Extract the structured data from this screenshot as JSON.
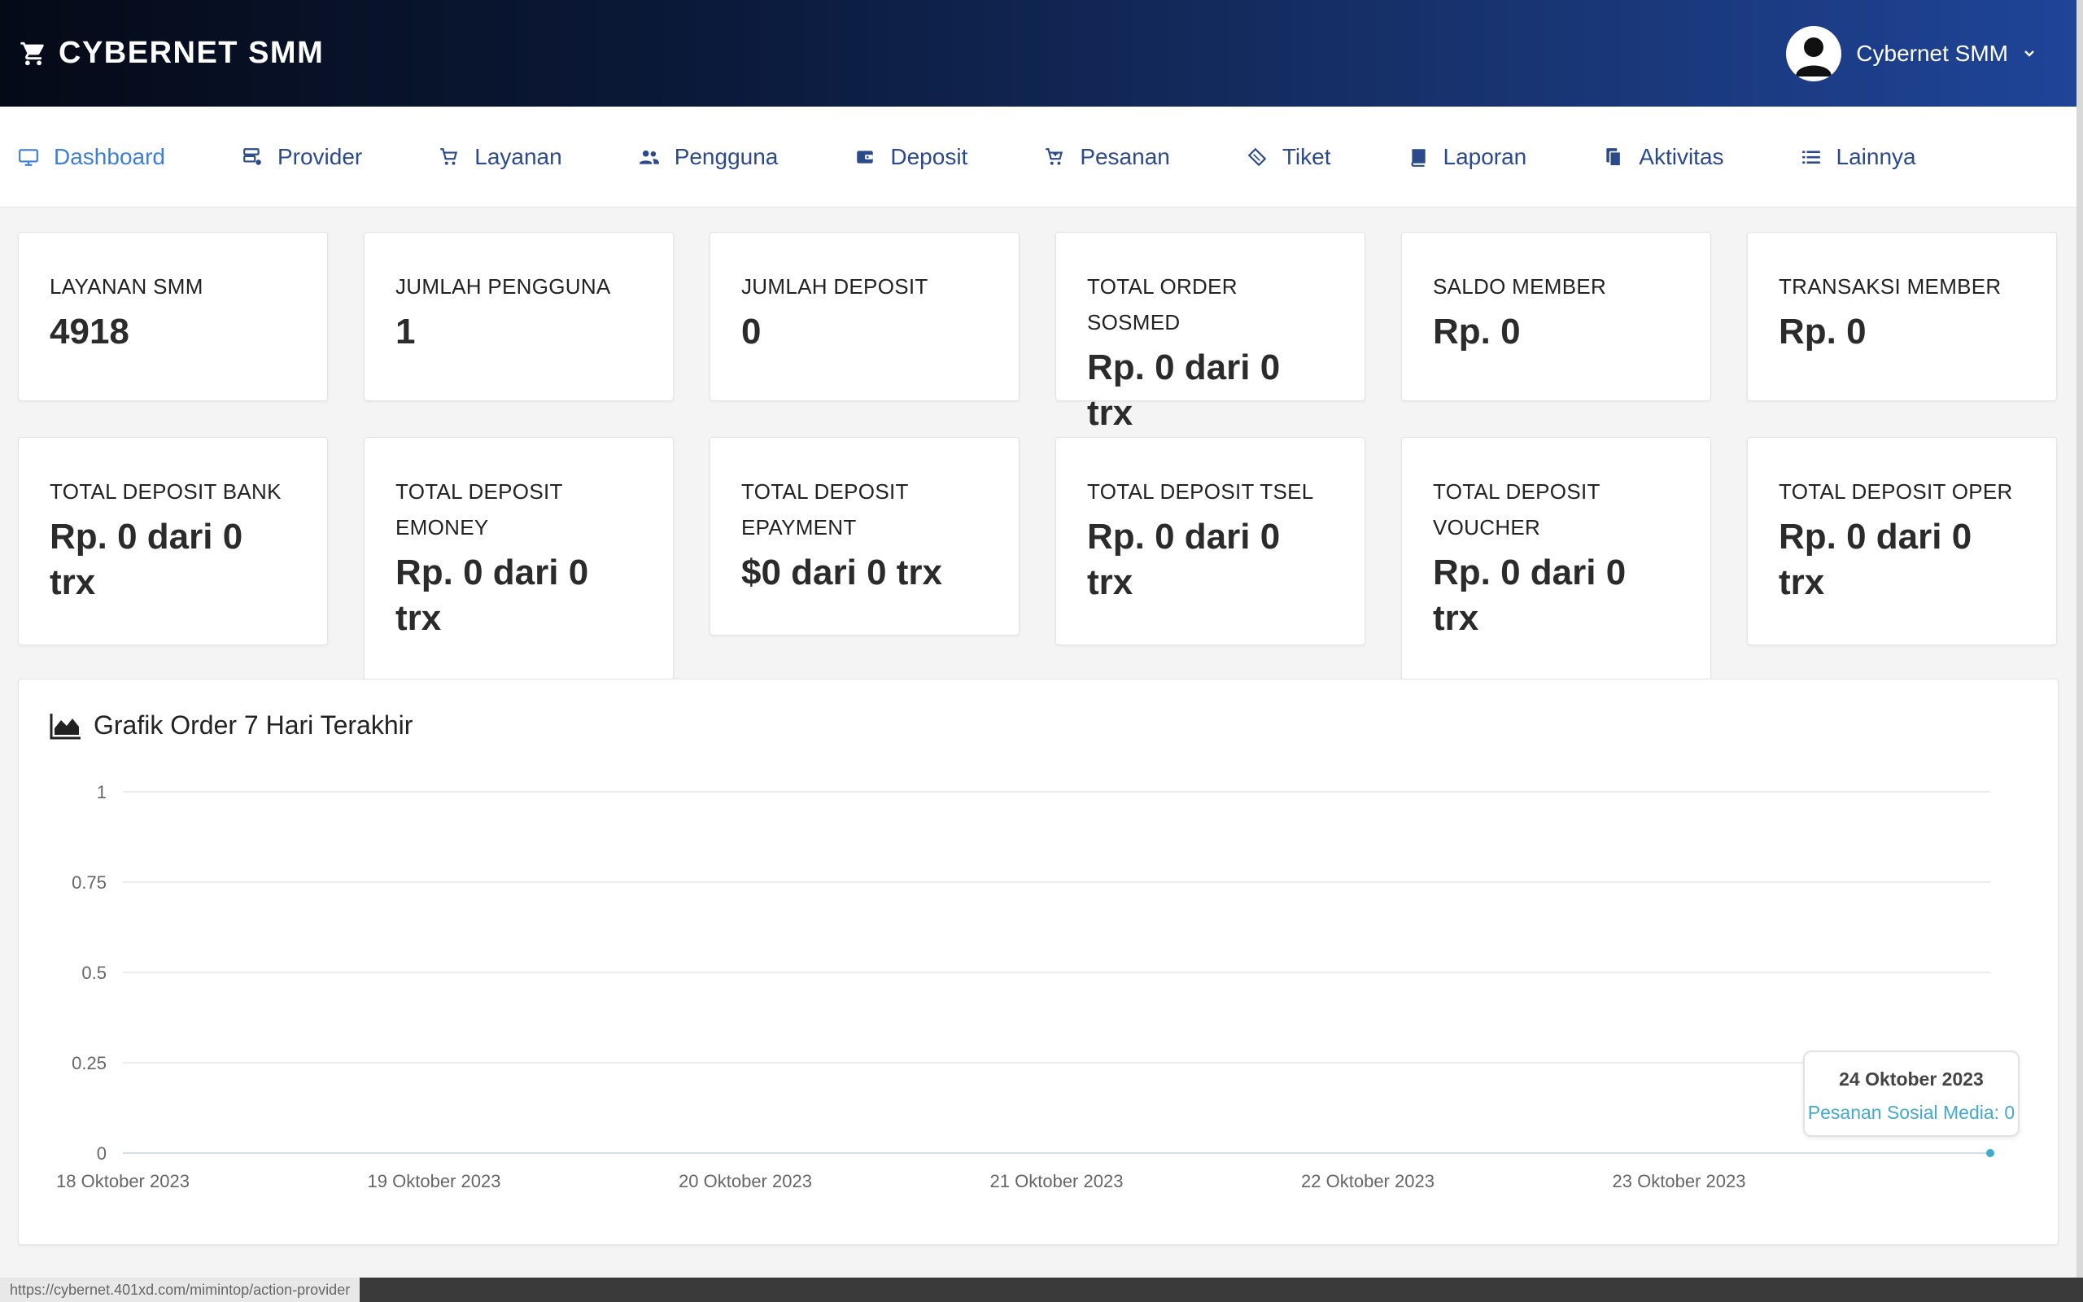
{
  "header": {
    "brand_icon": "cart-icon",
    "brand": "CYBERNET SMM",
    "user_name": "Cybernet SMM",
    "avatar_icon": "user-avatar-icon",
    "dropdown_icon": "chevron-down-icon"
  },
  "nav": {
    "items": [
      {
        "label": "Dashboard",
        "icon": "monitor-icon",
        "active": true
      },
      {
        "label": "Provider",
        "icon": "server-icon"
      },
      {
        "label": "Layanan",
        "icon": "cart-icon"
      },
      {
        "label": "Pengguna",
        "icon": "users-icon"
      },
      {
        "label": "Deposit",
        "icon": "wallet-icon"
      },
      {
        "label": "Pesanan",
        "icon": "cart-plus-icon"
      },
      {
        "label": "Tiket",
        "icon": "ticket-icon"
      },
      {
        "label": "Laporan",
        "icon": "book-icon"
      },
      {
        "label": "Aktivitas",
        "icon": "documents-icon"
      },
      {
        "label": "Lainnya",
        "icon": "list-icon"
      }
    ]
  },
  "stats_row1": [
    {
      "label": "LAYANAN SMM",
      "value": "4918"
    },
    {
      "label": "JUMLAH PENGGUNA",
      "value": "1"
    },
    {
      "label": "JUMLAH DEPOSIT",
      "value": "0"
    },
    {
      "label": "TOTAL ORDER SOSMED",
      "value": "Rp. 0 dari 0 trx"
    },
    {
      "label": "SALDO MEMBER",
      "value": "Rp. 0"
    },
    {
      "label": "TRANSAKSI MEMBER",
      "value": "Rp. 0"
    }
  ],
  "stats_row2": [
    {
      "label": "TOTAL DEPOSIT BANK",
      "value": "Rp. 0 dari 0 trx"
    },
    {
      "label": "TOTAL DEPOSIT EMONEY",
      "value": "Rp. 0 dari 0 trx"
    },
    {
      "label": "TOTAL DEPOSIT EPAYMENT",
      "value": "$0 dari 0 trx"
    },
    {
      "label": "TOTAL DEPOSIT TSEL",
      "value": "Rp. 0 dari 0 trx"
    },
    {
      "label": "TOTAL DEPOSIT VOUCHER",
      "value": "Rp. 0 dari 0 trx"
    },
    {
      "label": "TOTAL DEPOSIT OPER",
      "value": "Rp. 0 dari 0 trx"
    }
  ],
  "chart_panel": {
    "title": "Grafik Order 7 Hari Terakhir",
    "title_icon": "area-chart-icon"
  },
  "chart_data": {
    "type": "line",
    "title": "Grafik Order 7 Hari Terakhir",
    "categories": [
      "18 Oktober 2023",
      "19 Oktober 2023",
      "20 Oktober 2023",
      "21 Oktober 2023",
      "22 Oktober 2023",
      "23 Oktober 2023",
      "24 Oktober 2023"
    ],
    "x_tick_labels": [
      "18 Oktober 2023",
      "19 Oktober 2023",
      "20 Oktober 2023",
      "21 Oktober 2023",
      "22 Oktober 2023",
      "23 Oktober 2023"
    ],
    "y_ticks": [
      "0",
      "0.25",
      "0.5",
      "0.75",
      "1"
    ],
    "ylim": [
      0,
      1
    ],
    "grid": true,
    "series": [
      {
        "name": "Pesanan Sosial Media",
        "values": [
          0,
          0,
          0,
          0,
          0,
          0,
          0
        ],
        "color": "#41aacd"
      }
    ],
    "tooltip": {
      "date": "24 Oktober 2023",
      "text": "Pesanan Sosial Media: 0"
    }
  },
  "status_bar": {
    "url": "https://cybernet.401xd.com/mimintop/action-provider"
  },
  "colors": {
    "accent": "#3d7fd8",
    "nav_text": "#2b4a8c",
    "series": "#41aacd"
  }
}
